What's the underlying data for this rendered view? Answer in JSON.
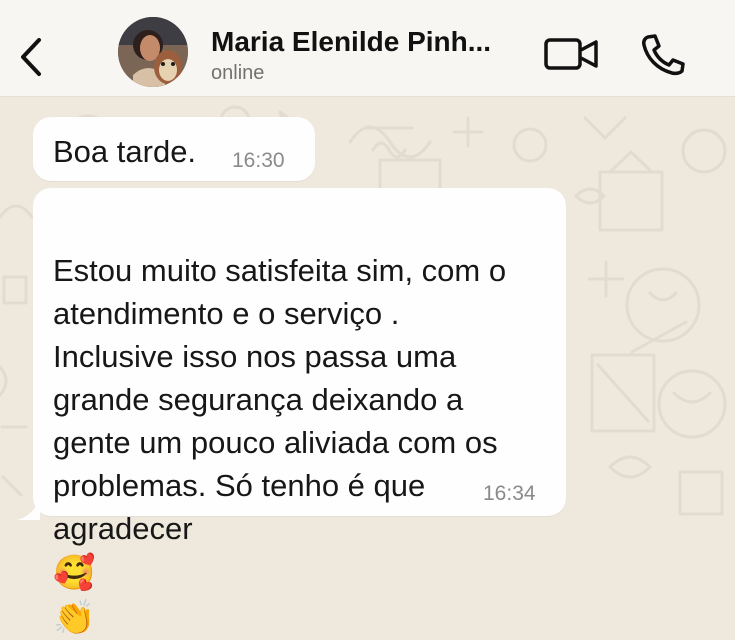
{
  "header": {
    "back_icon": "chevron-left-icon",
    "contact_name": "Maria Elenilde Pinh...",
    "status": "online",
    "video_icon": "video-camera-icon",
    "phone_icon": "phone-icon"
  },
  "messages": [
    {
      "text": "Boa tarde.",
      "time": "16:30"
    },
    {
      "text": "Estou muito satisfeita sim, com o\natendimento e o serviço .\nInclusive isso nos passa uma\ngrande segurança deixando a\ngente um pouco aliviada com os\nproblemas. Só tenho é que\nagradecer",
      "emoji_1": "🥰",
      "emoji_2": "👏",
      "time": "16:34"
    }
  ],
  "colors": {
    "chat_background": "#efe8dd",
    "header_background": "#f7f6f3",
    "bubble_background": "#fffefe",
    "muted_text": "#727272"
  }
}
